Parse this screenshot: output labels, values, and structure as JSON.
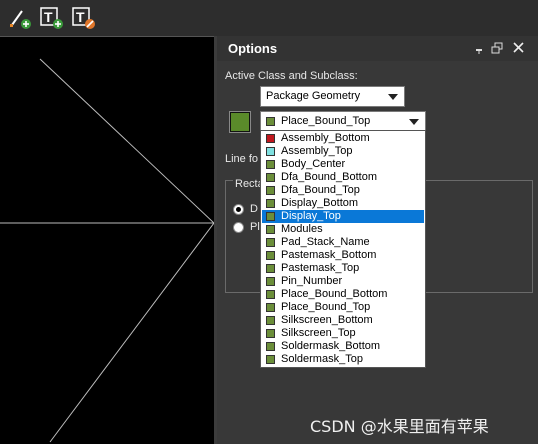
{
  "toolbar": {
    "buttons": [
      {
        "name": "add-line-tool",
        "icon": "pencil-plus-icon"
      },
      {
        "name": "add-text-tool",
        "icon": "text-plus-icon"
      },
      {
        "name": "edit-text-tool",
        "icon": "text-edit-icon"
      }
    ]
  },
  "panel": {
    "title": "Options",
    "pin_icon": "pin-icon",
    "float_icon": "float-icon",
    "close_icon": "close-icon",
    "active_class_label": "Active Class and Subclass:",
    "class_value": "Package Geometry",
    "subclass_value": "Place_Bound_Top",
    "subclass_swatch_color": "#6b8e3a",
    "active_color": "#5a8a2a",
    "line_font_label": "Line fo",
    "group_label": "Recta",
    "radio_1_label": "D",
    "radio_2_label": "Pl"
  },
  "dropdown": {
    "items": [
      {
        "label": "Assembly_Bottom",
        "color": "#c0181e"
      },
      {
        "label": "Assembly_Top",
        "color": "#7fe0e0"
      },
      {
        "label": "Body_Center",
        "color": "#6b8e3a"
      },
      {
        "label": "Dfa_Bound_Bottom",
        "color": "#6b8e3a"
      },
      {
        "label": "Dfa_Bound_Top",
        "color": "#6b8e3a"
      },
      {
        "label": "Display_Bottom",
        "color": "#6b8e3a"
      },
      {
        "label": "Display_Top",
        "color": "#6b8e3a",
        "selected": true
      },
      {
        "label": "Modules",
        "color": "#6b8e3a"
      },
      {
        "label": "Pad_Stack_Name",
        "color": "#6b8e3a"
      },
      {
        "label": "Pastemask_Bottom",
        "color": "#6b8e3a"
      },
      {
        "label": "Pastemask_Top",
        "color": "#6b8e3a"
      },
      {
        "label": "Pin_Number",
        "color": "#6b8e3a"
      },
      {
        "label": "Place_Bound_Bottom",
        "color": "#6b8e3a"
      },
      {
        "label": "Place_Bound_Top",
        "color": "#6b8e3a"
      },
      {
        "label": "Silkscreen_Bottom",
        "color": "#6b8e3a"
      },
      {
        "label": "Silkscreen_Top",
        "color": "#6b8e3a"
      },
      {
        "label": "Soldermask_Bottom",
        "color": "#6b8e3a"
      },
      {
        "label": "Soldermask_Top",
        "color": "#6b8e3a"
      }
    ]
  },
  "watermark": "CSDN @水果里面有苹果"
}
